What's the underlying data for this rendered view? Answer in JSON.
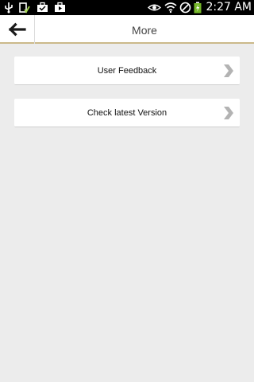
{
  "status_bar": {
    "time": "2:27 AM",
    "left_icons": [
      "usb-icon",
      "sim-check-icon",
      "briefcase-icon",
      "bag-icon"
    ],
    "right_icons": [
      "eye-icon",
      "wifi-icon",
      "no-signal-icon",
      "battery-charging-icon"
    ]
  },
  "header": {
    "title": "More",
    "back_icon": "back-arrow-icon"
  },
  "menu": {
    "items": [
      {
        "label": "User Feedback",
        "icon": "chevron-right-icon"
      },
      {
        "label": "Check latest Version",
        "icon": "chevron-right-icon"
      }
    ]
  },
  "colors": {
    "background": "#ececec",
    "header_accent": "#cbb98a",
    "chevron": "#b3b3b3"
  }
}
